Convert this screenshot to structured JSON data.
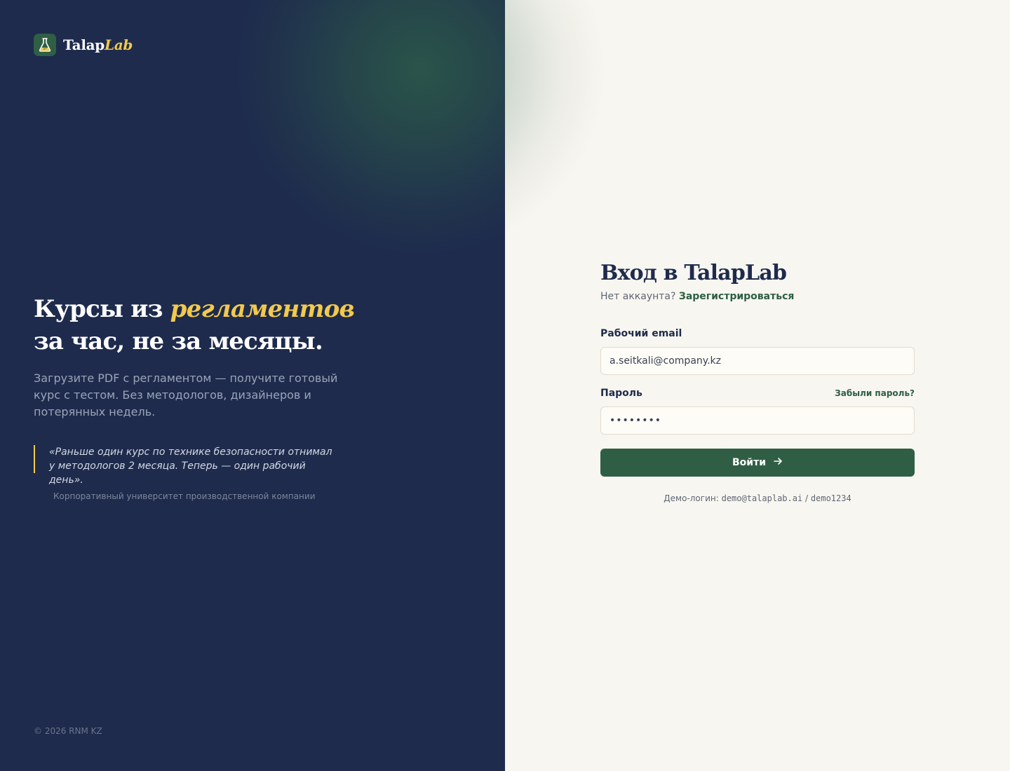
{
  "brand": {
    "name_main": "Talap",
    "name_accent": "Lab",
    "logo_icon": "flask-icon"
  },
  "hero": {
    "title_before": "Курсы из ",
    "title_highlight": "регламентов",
    "title_line2": "за час, не за месяцы.",
    "subtitle": "Загрузите PDF с регламентом — получите готовый курс с тестом. Без методологов, дизайнеров и потерянных недель."
  },
  "quote": {
    "text": "«Раньше один курс по технике безопасности отнимал у методологов 2 месяца. Теперь — один рабочий день».",
    "author": "Корпоративный университет производственной компании"
  },
  "footer": {
    "copyright": "© 2026 RNM KZ"
  },
  "form": {
    "title": "Вход в TalapLab",
    "no_account_text": "Нет аккаунта?",
    "register_link": "Зарегистрироваться",
    "email_label": "Рабочий email",
    "email_value": "a.seitkali@company.kz",
    "password_label": "Пароль",
    "forgot_link": "Забыли пароль?",
    "password_value": "••••••••",
    "submit_label": "Войти",
    "demo_prefix": "Демо-логин:",
    "demo_email": "demo@talaplab.ai",
    "demo_separator": "/",
    "demo_password": "demo1234"
  },
  "colors": {
    "left_bg": "#1e2b4d",
    "right_bg": "#f8f6f0",
    "accent_yellow": "#f2c94c",
    "primary_green": "#2f5e45"
  }
}
